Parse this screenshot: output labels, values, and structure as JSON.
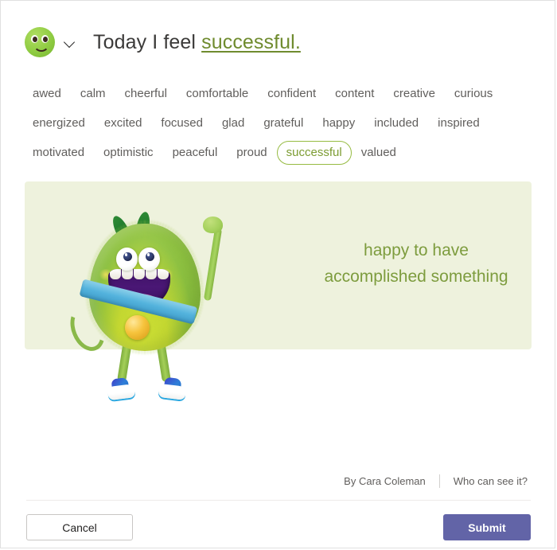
{
  "header": {
    "emoji_icon": "green-smiley-face",
    "dropdown_icon": "chevron-down-icon",
    "prefix": "Today I feel ",
    "selected_mood": "successful."
  },
  "moods": {
    "rows": [
      [
        "awed",
        "calm",
        "cheerful",
        "comfortable",
        "confident",
        "content",
        "creative",
        "curious"
      ],
      [
        "energized",
        "excited",
        "focused",
        "glad",
        "grateful",
        "happy",
        "included",
        "inspired"
      ],
      [
        "motivated",
        "optimistic",
        "peaceful",
        "proud",
        "successful",
        "valued"
      ]
    ],
    "selected": "successful"
  },
  "panel": {
    "caption_line1": "happy to have",
    "caption_line2": "accomplished something",
    "illustration": "green-fuzzy-monster-with-medal",
    "background_color": "#eef2dd",
    "caption_color": "#7d9c3e"
  },
  "footer": {
    "author": "By Cara Coleman",
    "privacy_link": "Who can see it?"
  },
  "actions": {
    "cancel_label": "Cancel",
    "submit_label": "Submit",
    "submit_color": "#6264a7"
  }
}
